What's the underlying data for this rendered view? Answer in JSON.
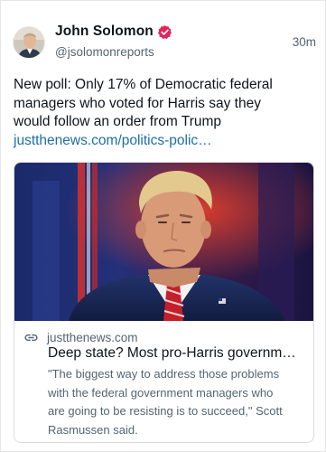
{
  "post": {
    "author": {
      "display_name": "John Solomon",
      "handle": "@jsolomonreports",
      "verified_icon": "verified-badge-icon",
      "verified_color": "#e0245e"
    },
    "timestamp": "30m",
    "text_lines": [
      "New poll: Only 17% of Democratic federal",
      "managers who voted for Harris say they",
      "would follow an order from Trump"
    ],
    "link_text": "justthenews.com/politics-polic…",
    "link_color": "#1d6fa5"
  },
  "link_card": {
    "image": "photo-of-man-in-suit-red-striped-tie",
    "link_icon": "link-chain-icon",
    "domain": "justthenews.com",
    "title": "Deep state? Most pro-Harris governm…",
    "description_lines": [
      "\"The biggest way to address those problems",
      "with the federal government managers who",
      "are going to be resisting is to succeed,\" Scott",
      "Rasmussen said."
    ]
  }
}
